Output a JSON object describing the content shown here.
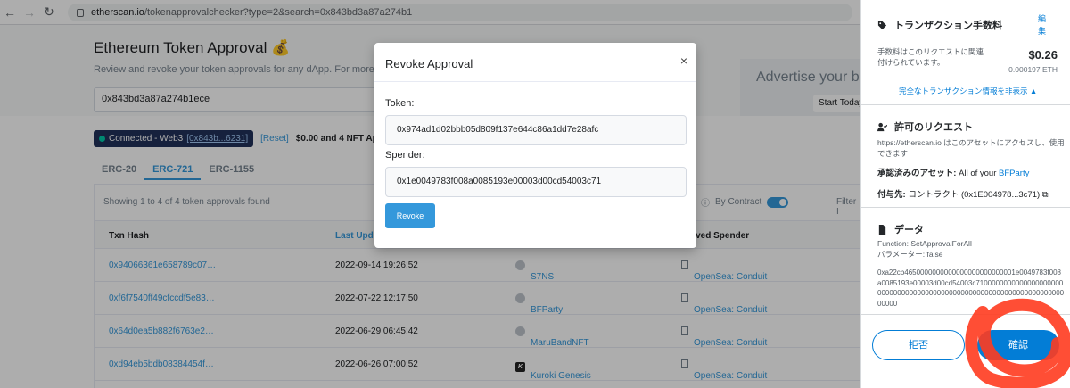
{
  "browser": {
    "url_host": "etherscan.io",
    "url_path": "/tokenapprovalchecker?type=2&search=0x843bd3a87a274b1"
  },
  "page": {
    "title": "Ethereum Token Approval",
    "title_emoji": "💰",
    "subtitle": "Review and revoke your token approvals for any dApp. For more inforr",
    "search_value": "0x843bd3a87a274b1ece",
    "ad_title": "Advertise your b",
    "ad_button": "Start Today",
    "connected_label": "Connected - Web3",
    "connected_addr": "[0x843b...6231]",
    "reset": "[Reset]",
    "summary": "$0.00 and 4 NFT Approv",
    "tabs": [
      "ERC-20",
      "ERC-721",
      "ERC-1155"
    ],
    "active_tab": 1,
    "showing": "Showing 1 to 4 of 4 token approvals found",
    "by_contract": "By Contract",
    "filter": "Filter I",
    "columns": [
      "Txn Hash",
      "Last Upda",
      "",
      "proved Spender"
    ],
    "rows": [
      {
        "hash": "0x94066361e658789c07…",
        "date": "2022-09-14 19:26:52",
        "token": "S7NS",
        "spender": "OpenSea: Conduit"
      },
      {
        "hash": "0xf6f7540ff49cfccdf5e83…",
        "date": "2022-07-22 12:17:50",
        "token": "BFParty",
        "spender": "OpenSea: Conduit"
      },
      {
        "hash": "0x64d0ea5b882f6763e2…",
        "date": "2022-06-29 06:45:42",
        "token": "MaruBandNFT",
        "spender": "OpenSea: Conduit"
      },
      {
        "hash": "0xd94eb5bdb08384454f…",
        "date": "2022-06-26 07:00:52",
        "token": "Kuroki Genesis",
        "spender": "OpenSea: Conduit"
      }
    ]
  },
  "modal": {
    "title": "Revoke Approval",
    "close": "×",
    "token_label": "Token:",
    "token_value": "0x974ad1d02bbb05d809f137e644c86a1dd7e28afc",
    "spender_label": "Spender:",
    "spender_value": "0x1e0049783f008a0085193e00003d00cd54003c71",
    "button": "Revoke"
  },
  "metamask": {
    "fee_title": "トランザクション手数料",
    "edit": "編集",
    "fee_desc": "手数料はこのリクエストに関連付けられています。",
    "fee_usd": "$0.26",
    "fee_eth": "0.000197 ETH",
    "hide_details": "完全なトランザクション情報を非表示 ▲",
    "perm_title": "許可のリクエスト",
    "perm_desc": "https://etherscan.io はこのアセットにアクセスし、使用できます",
    "approved_label": "承認済みのアセット:",
    "approved_value": "All of your",
    "approved_link": "BFParty",
    "grant_label": "付与先:",
    "grant_value": "コントラクト (0x1E004978...3c71)",
    "data_title": "データ",
    "function": "Function: SetApprovalForAll",
    "params": "パラメーター: false",
    "hex": "0xa22cb4650000000000000000000000001e0049783f008a0085193e00003d00cd54003c71000000000000000000000000000000000000000000000000000000000000000000000000",
    "reject": "拒否",
    "confirm": "確認"
  },
  "colors": {
    "accent": "#3498db",
    "metamask_blue": "#037dd6",
    "scribble": "#ff3b1f"
  }
}
